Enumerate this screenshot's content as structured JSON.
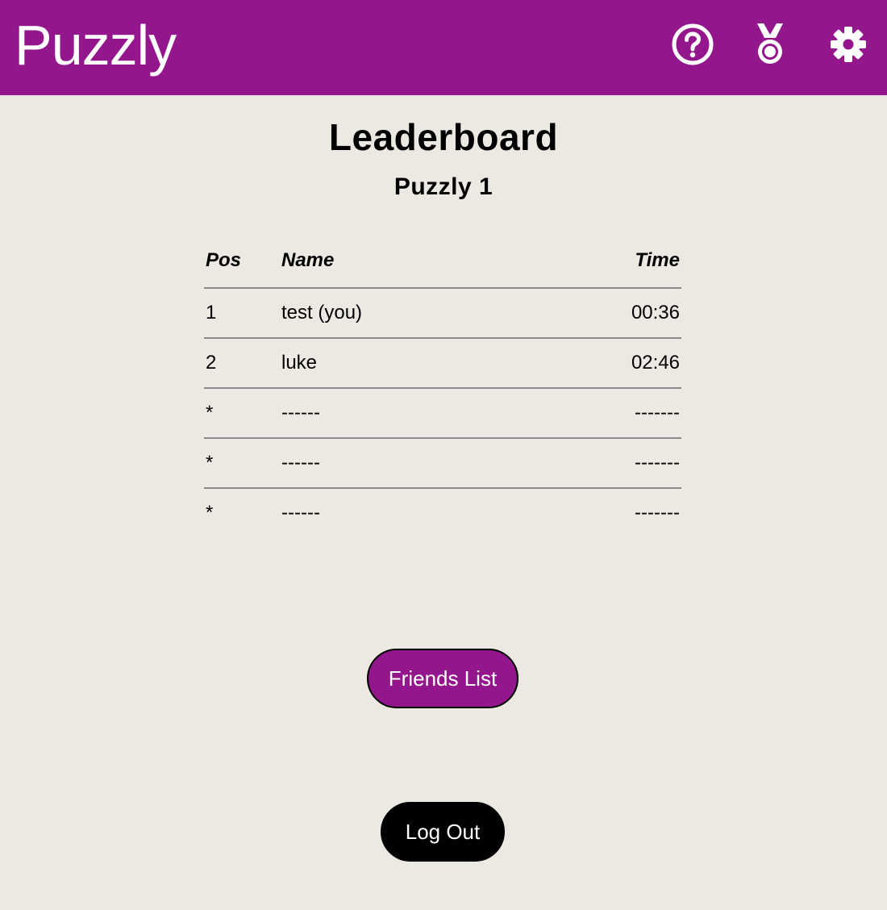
{
  "header": {
    "app_title": "Puzzly",
    "bg_color": "#93168d",
    "icons": [
      "help-circle-icon",
      "medal-icon",
      "gear-icon"
    ]
  },
  "page": {
    "title": "Leaderboard",
    "puzzle_name": "Puzzly 1",
    "bg_color": "#ece8e2"
  },
  "leaderboard": {
    "headers": {
      "pos": "Pos",
      "name": "Name",
      "time": "Time"
    },
    "rows": [
      {
        "pos": "1",
        "name": "test (you)",
        "time": "00:36"
      },
      {
        "pos": "2",
        "name": "luke",
        "time": "02:46"
      },
      {
        "pos": "*",
        "name": "------",
        "time": "-------"
      },
      {
        "pos": "*",
        "name": "------",
        "time": "-------"
      },
      {
        "pos": "*",
        "name": "------",
        "time": "-------"
      }
    ]
  },
  "buttons": {
    "friends_list": "Friends List",
    "log_out": "Log Out"
  }
}
